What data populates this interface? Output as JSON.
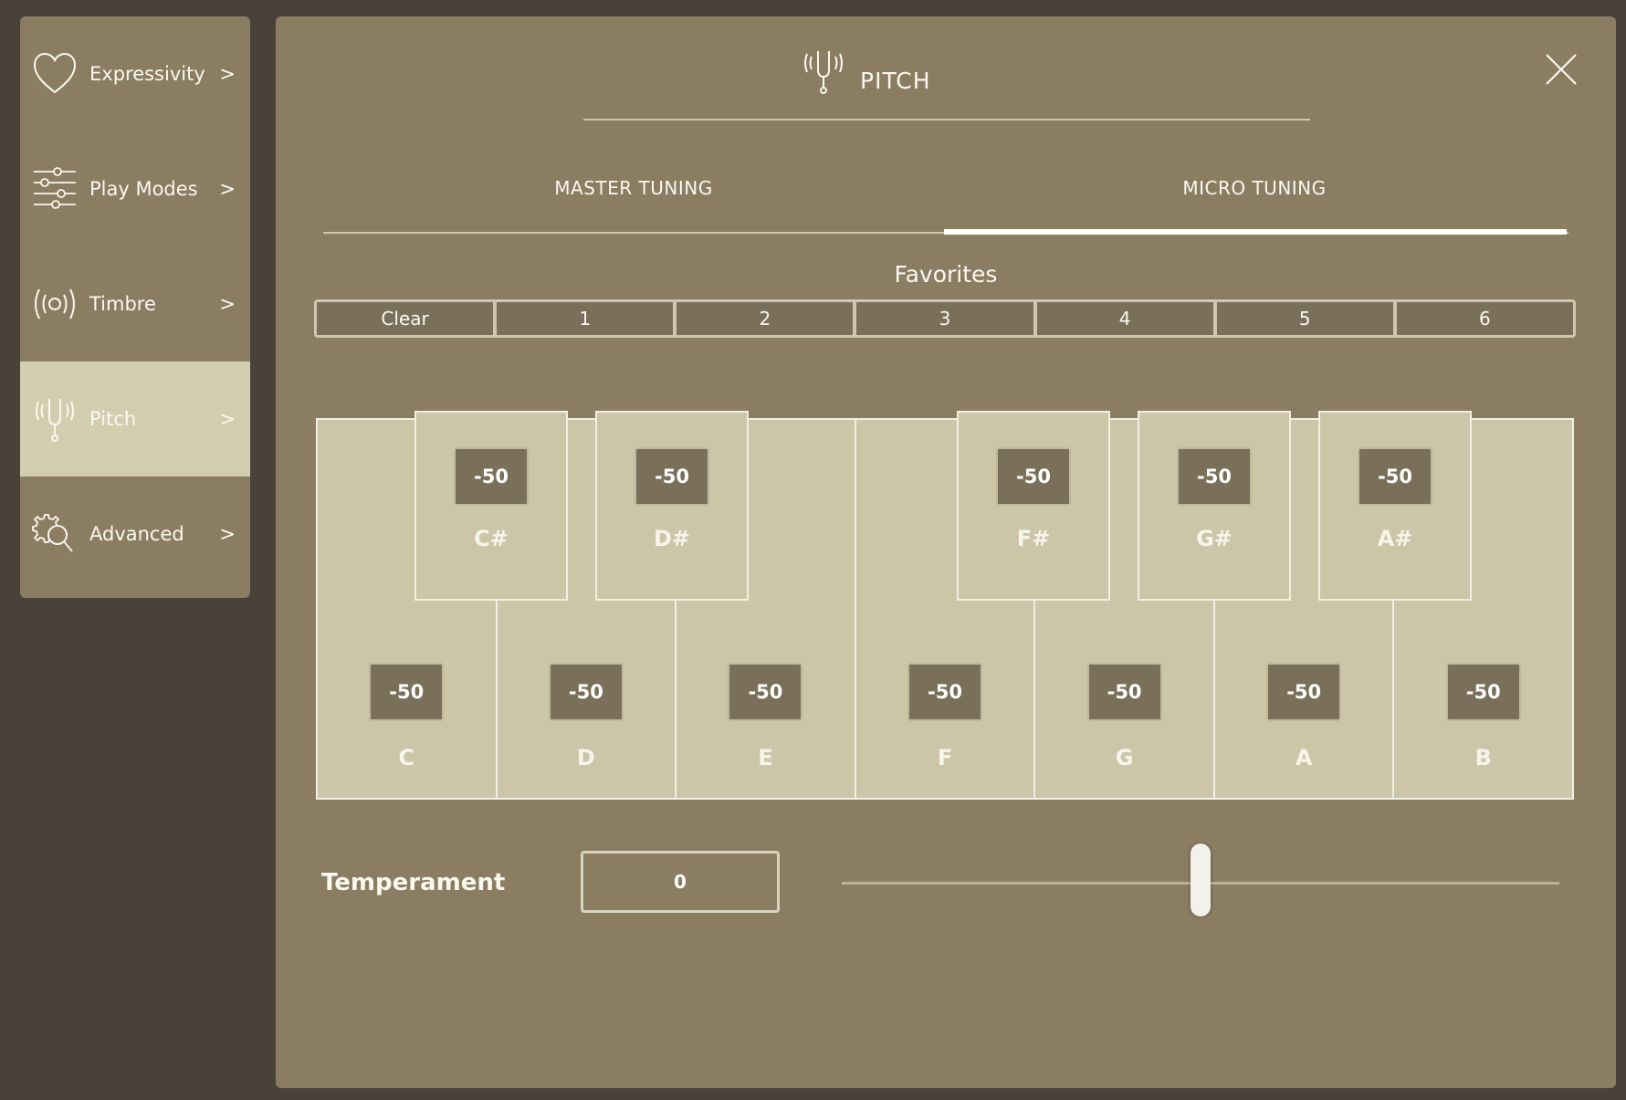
{
  "sidebar": {
    "items": [
      {
        "label": "Expressivity",
        "arrow": ">",
        "icon": "heart-icon"
      },
      {
        "label": "Play Modes",
        "arrow": ">",
        "icon": "sliders-icon"
      },
      {
        "label": "Timbre",
        "arrow": ">",
        "icon": "radio-waves-icon"
      },
      {
        "label": "Pitch",
        "arrow": ">",
        "icon": "tuning-fork-icon",
        "active": true
      },
      {
        "label": "Advanced",
        "arrow": ">",
        "icon": "gear-search-icon"
      }
    ]
  },
  "header": {
    "title": "PITCH",
    "icon": "tuning-fork-icon",
    "close_icon": "close-icon"
  },
  "tabs": [
    {
      "label": "MASTER TUNING",
      "active": false
    },
    {
      "label": "MICRO TUNING",
      "active": true
    }
  ],
  "favorites": {
    "title": "Favorites",
    "buttons": [
      "Clear",
      "1",
      "2",
      "3",
      "4",
      "5",
      "6"
    ]
  },
  "keyboard": {
    "white_keys": [
      {
        "name": "C",
        "value": "-50"
      },
      {
        "name": "D",
        "value": "-50"
      },
      {
        "name": "E",
        "value": "-50"
      },
      {
        "name": "F",
        "value": "-50"
      },
      {
        "name": "G",
        "value": "-50"
      },
      {
        "name": "A",
        "value": "-50"
      },
      {
        "name": "B",
        "value": "-50"
      }
    ],
    "black_keys": [
      {
        "name": "C#",
        "value": "-50"
      },
      {
        "name": "D#",
        "value": "-50"
      },
      {
        "name": "F#",
        "value": "-50"
      },
      {
        "name": "G#",
        "value": "-50"
      },
      {
        "name": "A#",
        "value": "-50"
      }
    ]
  },
  "temperament": {
    "label": "Temperament",
    "value": "0",
    "slider_fraction": 0.5
  },
  "colors": {
    "background": "#4a4239",
    "panel": "#8a7d62",
    "active_item": "#d3cdb0",
    "key_fill": "#ccc5a8",
    "value_box": "#7a705a"
  }
}
